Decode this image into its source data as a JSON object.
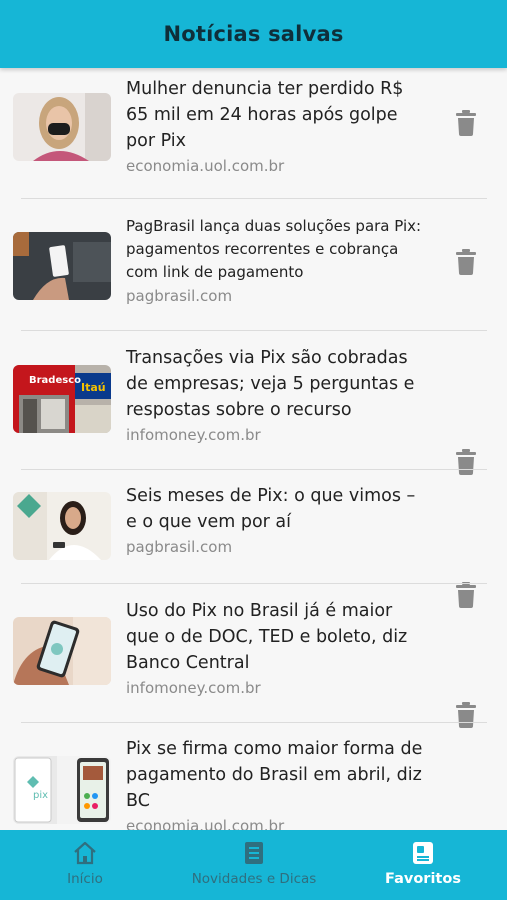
{
  "header": {
    "title": "Notícias salvas"
  },
  "articles": [
    {
      "title": "Mulher denuncia ter perdido R$ 65 mil em 24 horas após golpe por Pix",
      "source": "economia.uol.com.br"
    },
    {
      "title": "PagBrasil lança duas soluções para Pix: pagamentos recorrentes e cobrança com link de pagamento",
      "source": "pagbrasil.com"
    },
    {
      "title": "Transações via Pix são cobradas de empresas; veja 5 perguntas e respostas sobre o recurso",
      "source": "infomoney.com.br"
    },
    {
      "title": "Seis meses de Pix: o que vimos – e o que vem por aí",
      "source": "pagbrasil.com"
    },
    {
      "title": "Uso do Pix no Brasil já é maior que o de DOC, TED e boleto, diz Banco Central",
      "source": "infomoney.com.br"
    },
    {
      "title": "Pix se firma como maior forma de pagamento do Brasil em abril, diz BC",
      "source": "economia.uol.com.br"
    }
  ],
  "thumb_text": {
    "bank1": "Bradesco",
    "bank2": "Itaú",
    "pix": "pix"
  },
  "nav": {
    "items": [
      {
        "label": "Início",
        "icon": "home-icon"
      },
      {
        "label": "Novidades e Dicas",
        "icon": "news-icon"
      },
      {
        "label": "Favoritos",
        "icon": "favorites-icon"
      }
    ],
    "active": "Favoritos"
  },
  "colors": {
    "primary": "#16b6d6",
    "trash": "#8a8a8a",
    "active_nav": "#ffffff"
  }
}
